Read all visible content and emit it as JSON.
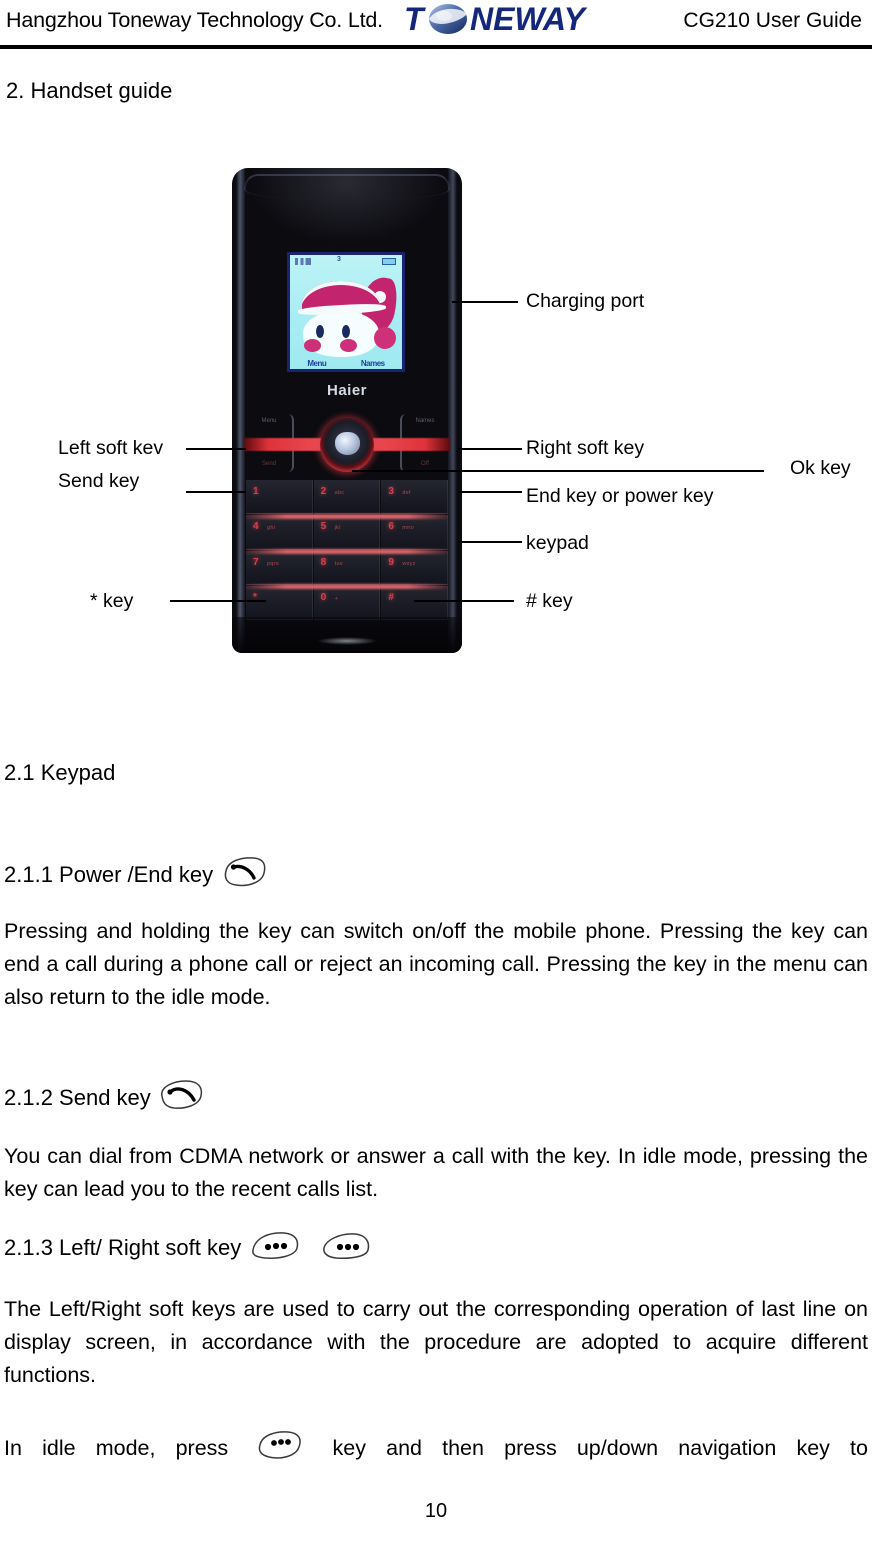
{
  "header": {
    "company": "Hangzhou Toneway Technology Co. Ltd.",
    "logo_text": "TONEWAY",
    "logo_pre": "T",
    "logo_post": "NEWAY",
    "doc_title": "CG210 User Guide"
  },
  "section": {
    "title": "2. Handset guide"
  },
  "figure": {
    "phone_brand": "Haier",
    "screen": {
      "softkey_left": "Menu",
      "softkey_right": "Names",
      "status_center": "3"
    },
    "keypad_softkey_top_left": "Menu",
    "keypad_softkey_bottom_left": "Send",
    "keypad_softkey_top_right": "Names",
    "keypad_softkey_bottom_right": "Off",
    "keys": [
      {
        "num": "1",
        "abc": ""
      },
      {
        "num": "2",
        "abc": "abc"
      },
      {
        "num": "3",
        "abc": "def"
      },
      {
        "num": "4",
        "abc": "ghi"
      },
      {
        "num": "5",
        "abc": "jkl"
      },
      {
        "num": "6",
        "abc": "mno"
      },
      {
        "num": "7",
        "abc": "pqrs"
      },
      {
        "num": "8",
        "abc": "tuv"
      },
      {
        "num": "9",
        "abc": "wxyz"
      },
      {
        "num": "*",
        "abc": ""
      },
      {
        "num": "0",
        "abc": "+"
      },
      {
        "num": "#",
        "abc": ""
      }
    ],
    "callouts": {
      "charging_port": "Charging port",
      "left_soft_key": "Left soft kev",
      "send_key": "Send key",
      "right_soft_key": "Right soft key",
      "ok_key": "Ok key",
      "end_key": "End key or power key",
      "keypad": "keypad",
      "star_key": "* key",
      "hash_key": "# key"
    }
  },
  "content": {
    "h_keypad": "2.1 Keypad",
    "h_power_end": "2.1.1 Power /End key",
    "p_power_end": "Pressing and holding the key can switch on/off the mobile phone. Pressing the key can end a call during a phone call or reject an incoming call. Pressing the key in the menu can also return to the idle mode.",
    "h_send": "2.1.2 Send key",
    "p_send": "You can dial from CDMA network or answer a call with the key. In idle mode, pressing the key can lead you to the recent calls list.",
    "h_soft": "2.1.3 Left/ Right soft key",
    "p_soft": "The Left/Right soft keys are used to carry out the corresponding operation of last line on display screen, in accordance with the procedure are adopted to acquire different functions.",
    "p_idle_a": "In idle mode, press",
    "p_idle_b": "key and then press up/down navigation key to"
  },
  "footer": {
    "page_number": "10"
  },
  "icons": {
    "end_key": "end-key-icon",
    "send_key": "send-key-icon",
    "left_soft_key": "left-soft-key-icon",
    "right_soft_key": "right-soft-key-icon"
  },
  "colors": {
    "logo_blue": "#14277a",
    "rule_black": "#000000",
    "key_red": "#d8404a",
    "screen_cyan": "#a8edf3"
  }
}
